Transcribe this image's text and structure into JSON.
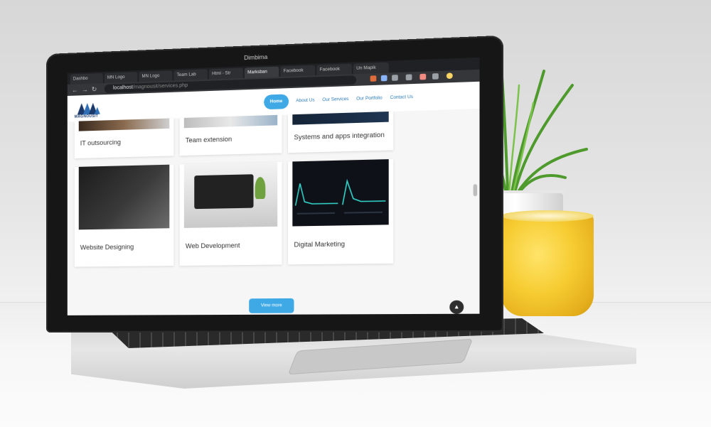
{
  "browser": {
    "bezel_label": "Dimbima",
    "tabs": [
      {
        "label": "Dashbo",
        "active": false
      },
      {
        "label": "MN Logo",
        "active": false
      },
      {
        "label": "MN Logo",
        "active": false
      },
      {
        "label": "Team Lab",
        "active": false
      },
      {
        "label": "Html - Str",
        "active": false
      },
      {
        "label": "Marksban",
        "active": true
      },
      {
        "label": "Facebook",
        "active": false
      },
      {
        "label": "Facebook",
        "active": false
      },
      {
        "label": "Un Mapik",
        "active": false
      }
    ],
    "url_host": "localhost",
    "url_path": "/magnousit/services.php",
    "nav_icons": [
      "back-icon",
      "forward-icon",
      "reload-icon"
    ]
  },
  "site": {
    "logo_text": "MAGNOUSIT",
    "menu": [
      {
        "label": "Home",
        "active": true
      },
      {
        "label": "About Us",
        "active": false
      },
      {
        "label": "Our Services",
        "active": false
      },
      {
        "label": "Our Portfolio",
        "active": false
      },
      {
        "label": "Contact Us",
        "active": false
      }
    ],
    "services": [
      "IT outsourcing",
      "Team extension",
      "Systems and apps integration",
      "Website Designing",
      "Web Development",
      "Digital Marketing"
    ],
    "view_more_label": "View more",
    "scroll_top_icon": "chevron-up-icon"
  },
  "colors": {
    "accent": "#3fa9e6",
    "brand_navy": "#1b3a6b",
    "mug_yellow": "#f6cc32",
    "plant_green": "#5fae3a"
  }
}
